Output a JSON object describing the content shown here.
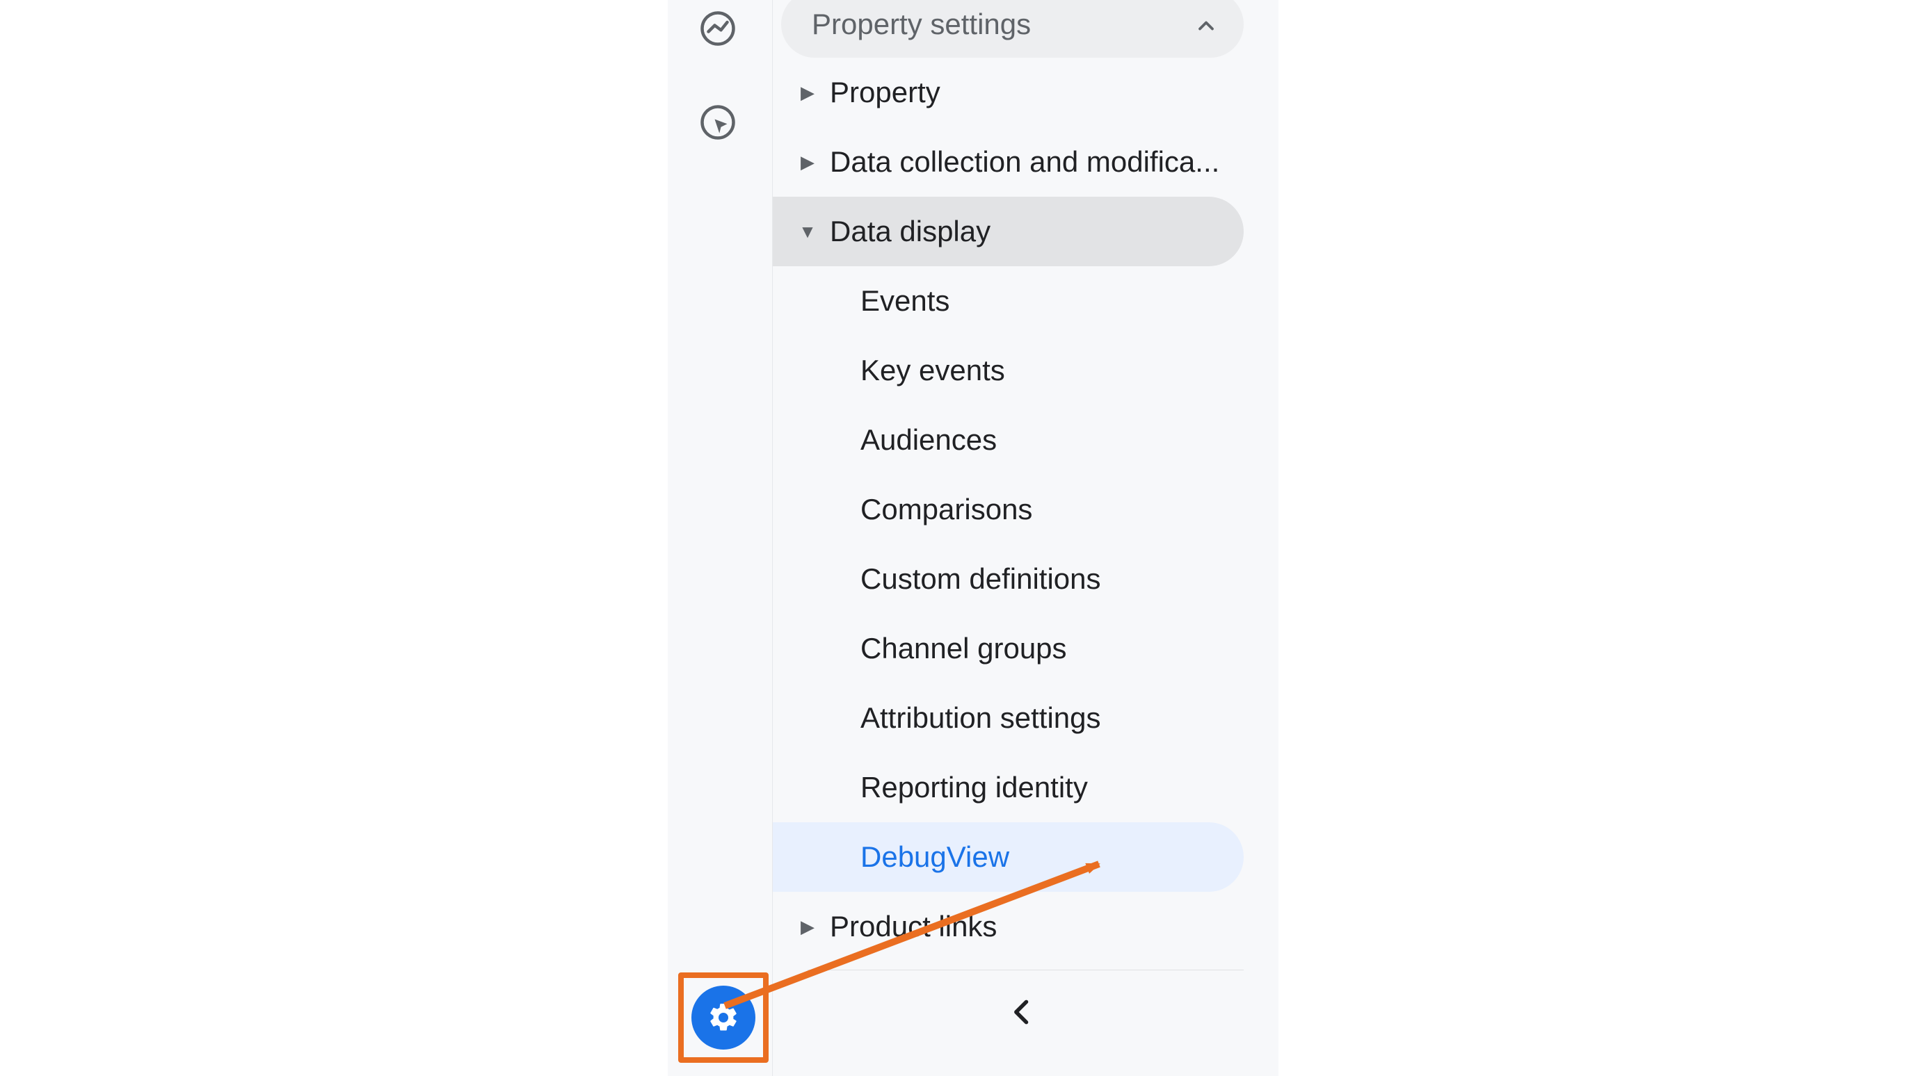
{
  "header": {
    "title": "Property settings"
  },
  "nav": {
    "items": [
      {
        "label": "Property",
        "expanded": false
      },
      {
        "label": "Data collection and modifica...",
        "expanded": false
      },
      {
        "label": "Data display",
        "expanded": true
      },
      {
        "label": "Product links",
        "expanded": false
      }
    ]
  },
  "data_display": {
    "children": [
      {
        "label": "Events",
        "selected": false
      },
      {
        "label": "Key events",
        "selected": false
      },
      {
        "label": "Audiences",
        "selected": false
      },
      {
        "label": "Comparisons",
        "selected": false
      },
      {
        "label": "Custom definitions",
        "selected": false
      },
      {
        "label": "Channel groups",
        "selected": false
      },
      {
        "label": "Attribution settings",
        "selected": false
      },
      {
        "label": "Reporting identity",
        "selected": false
      },
      {
        "label": "DebugView",
        "selected": true
      }
    ]
  }
}
